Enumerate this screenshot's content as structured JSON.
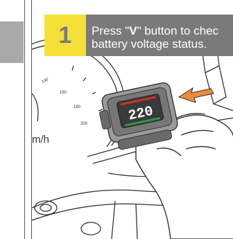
{
  "step": {
    "number": "1",
    "line1_before": "Press \"",
    "line1_symbol": "V",
    "line1_after": "\" button to chec",
    "line2": "battery voltage status."
  },
  "device": {
    "display_value": "220"
  },
  "speedometer": {
    "tick_labels": [
      "140",
      "160",
      "180",
      "200"
    ],
    "unit": "m/h"
  },
  "colors": {
    "banner": "#7a7a7a",
    "badge": "#f5e03a",
    "arrow": "#f08a3c",
    "display_red": "#d92b2b",
    "display_green": "#2d9b45"
  }
}
